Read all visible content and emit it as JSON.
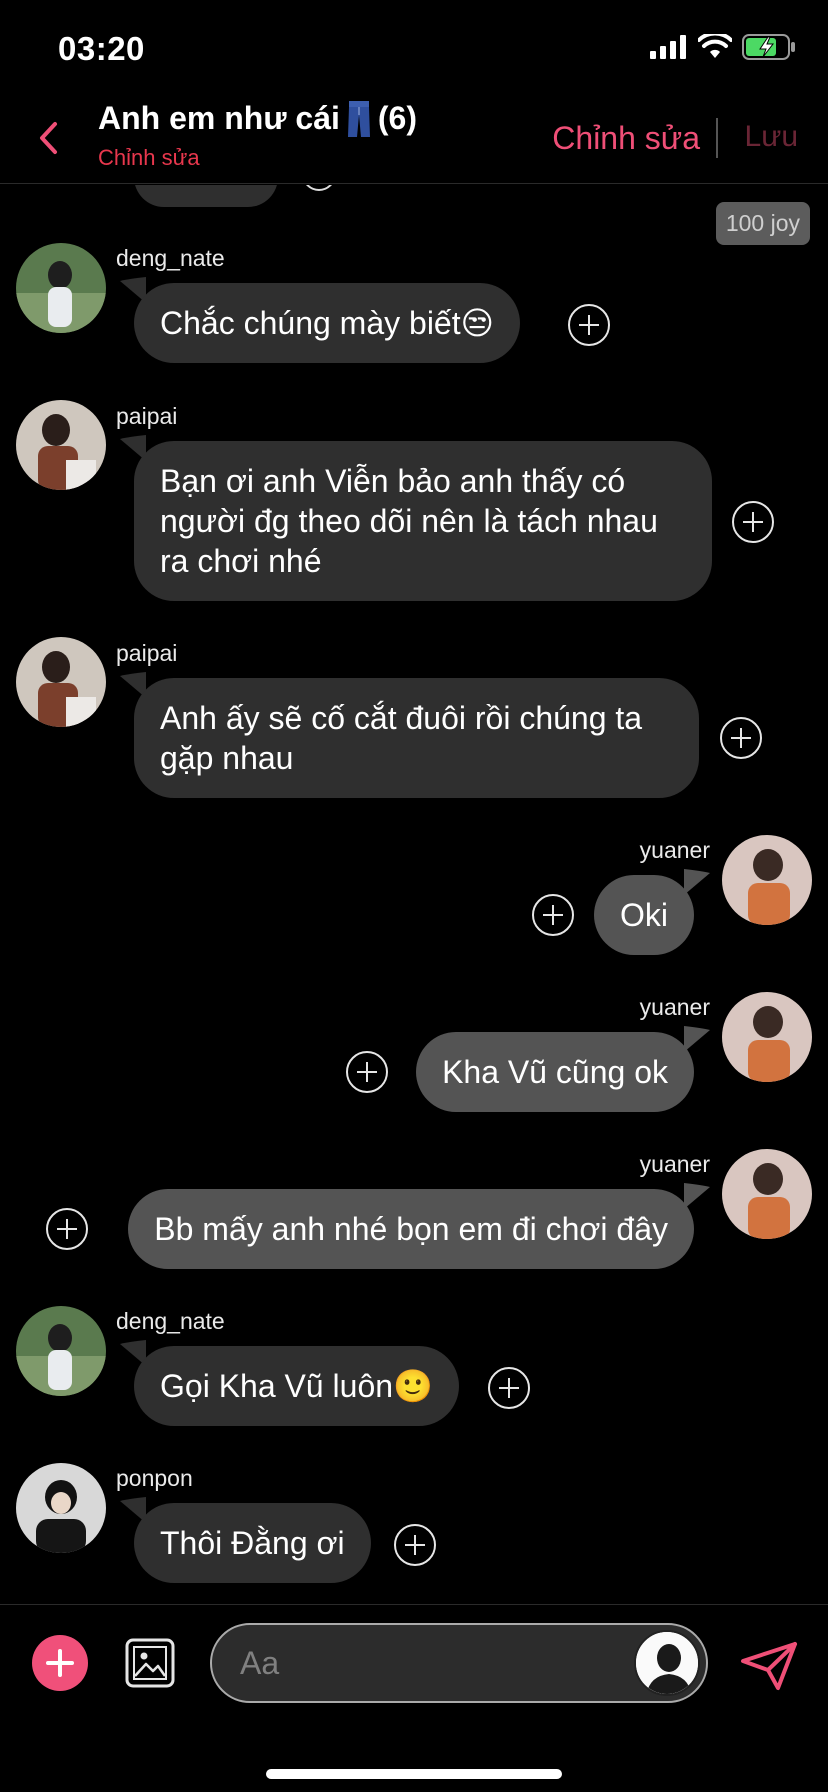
{
  "status_bar": {
    "time": "03:20"
  },
  "header": {
    "title": "Anh em như cái",
    "title_emoji": "jeans-emoji",
    "count": "(6)",
    "subtitle": "Chỉnh sửa",
    "edit_label": "Chỉnh sửa",
    "save_label": "Lưu"
  },
  "chat": {
    "reward_badge": "100 joy",
    "messages": [
      {
        "sender": "deng_nate",
        "text": "Chắc chúng mày biết😒",
        "direction": "incoming"
      },
      {
        "sender": "paipai",
        "text": "Bạn ơi anh Viễn bảo anh thấy có người đg theo dõi nên là tách nhau ra chơi nhé",
        "direction": "incoming"
      },
      {
        "sender": "paipai",
        "text": "Anh ấy sẽ cố cắt đuôi rồi chúng ta gặp nhau",
        "direction": "incoming"
      },
      {
        "sender": "yuaner",
        "text": "Oki",
        "direction": "outgoing"
      },
      {
        "sender": "yuaner",
        "text": "Kha Vũ cũng ok",
        "direction": "outgoing"
      },
      {
        "sender": "yuaner",
        "text": "Bb mấy anh nhé bọn em đi chơi đây",
        "direction": "outgoing"
      },
      {
        "sender": "deng_nate",
        "text": "Gọi Kha Vũ luôn🙂",
        "direction": "incoming"
      },
      {
        "sender": "ponpon",
        "text": "Thôi Đằng ơi",
        "direction": "incoming"
      }
    ]
  },
  "composer": {
    "placeholder": "Aa"
  },
  "colors": {
    "accent": "#ef4f77",
    "incoming_bubble": "#2f2f2f",
    "outgoing_bubble": "#545454",
    "subtitle_red": "#e8374d"
  }
}
